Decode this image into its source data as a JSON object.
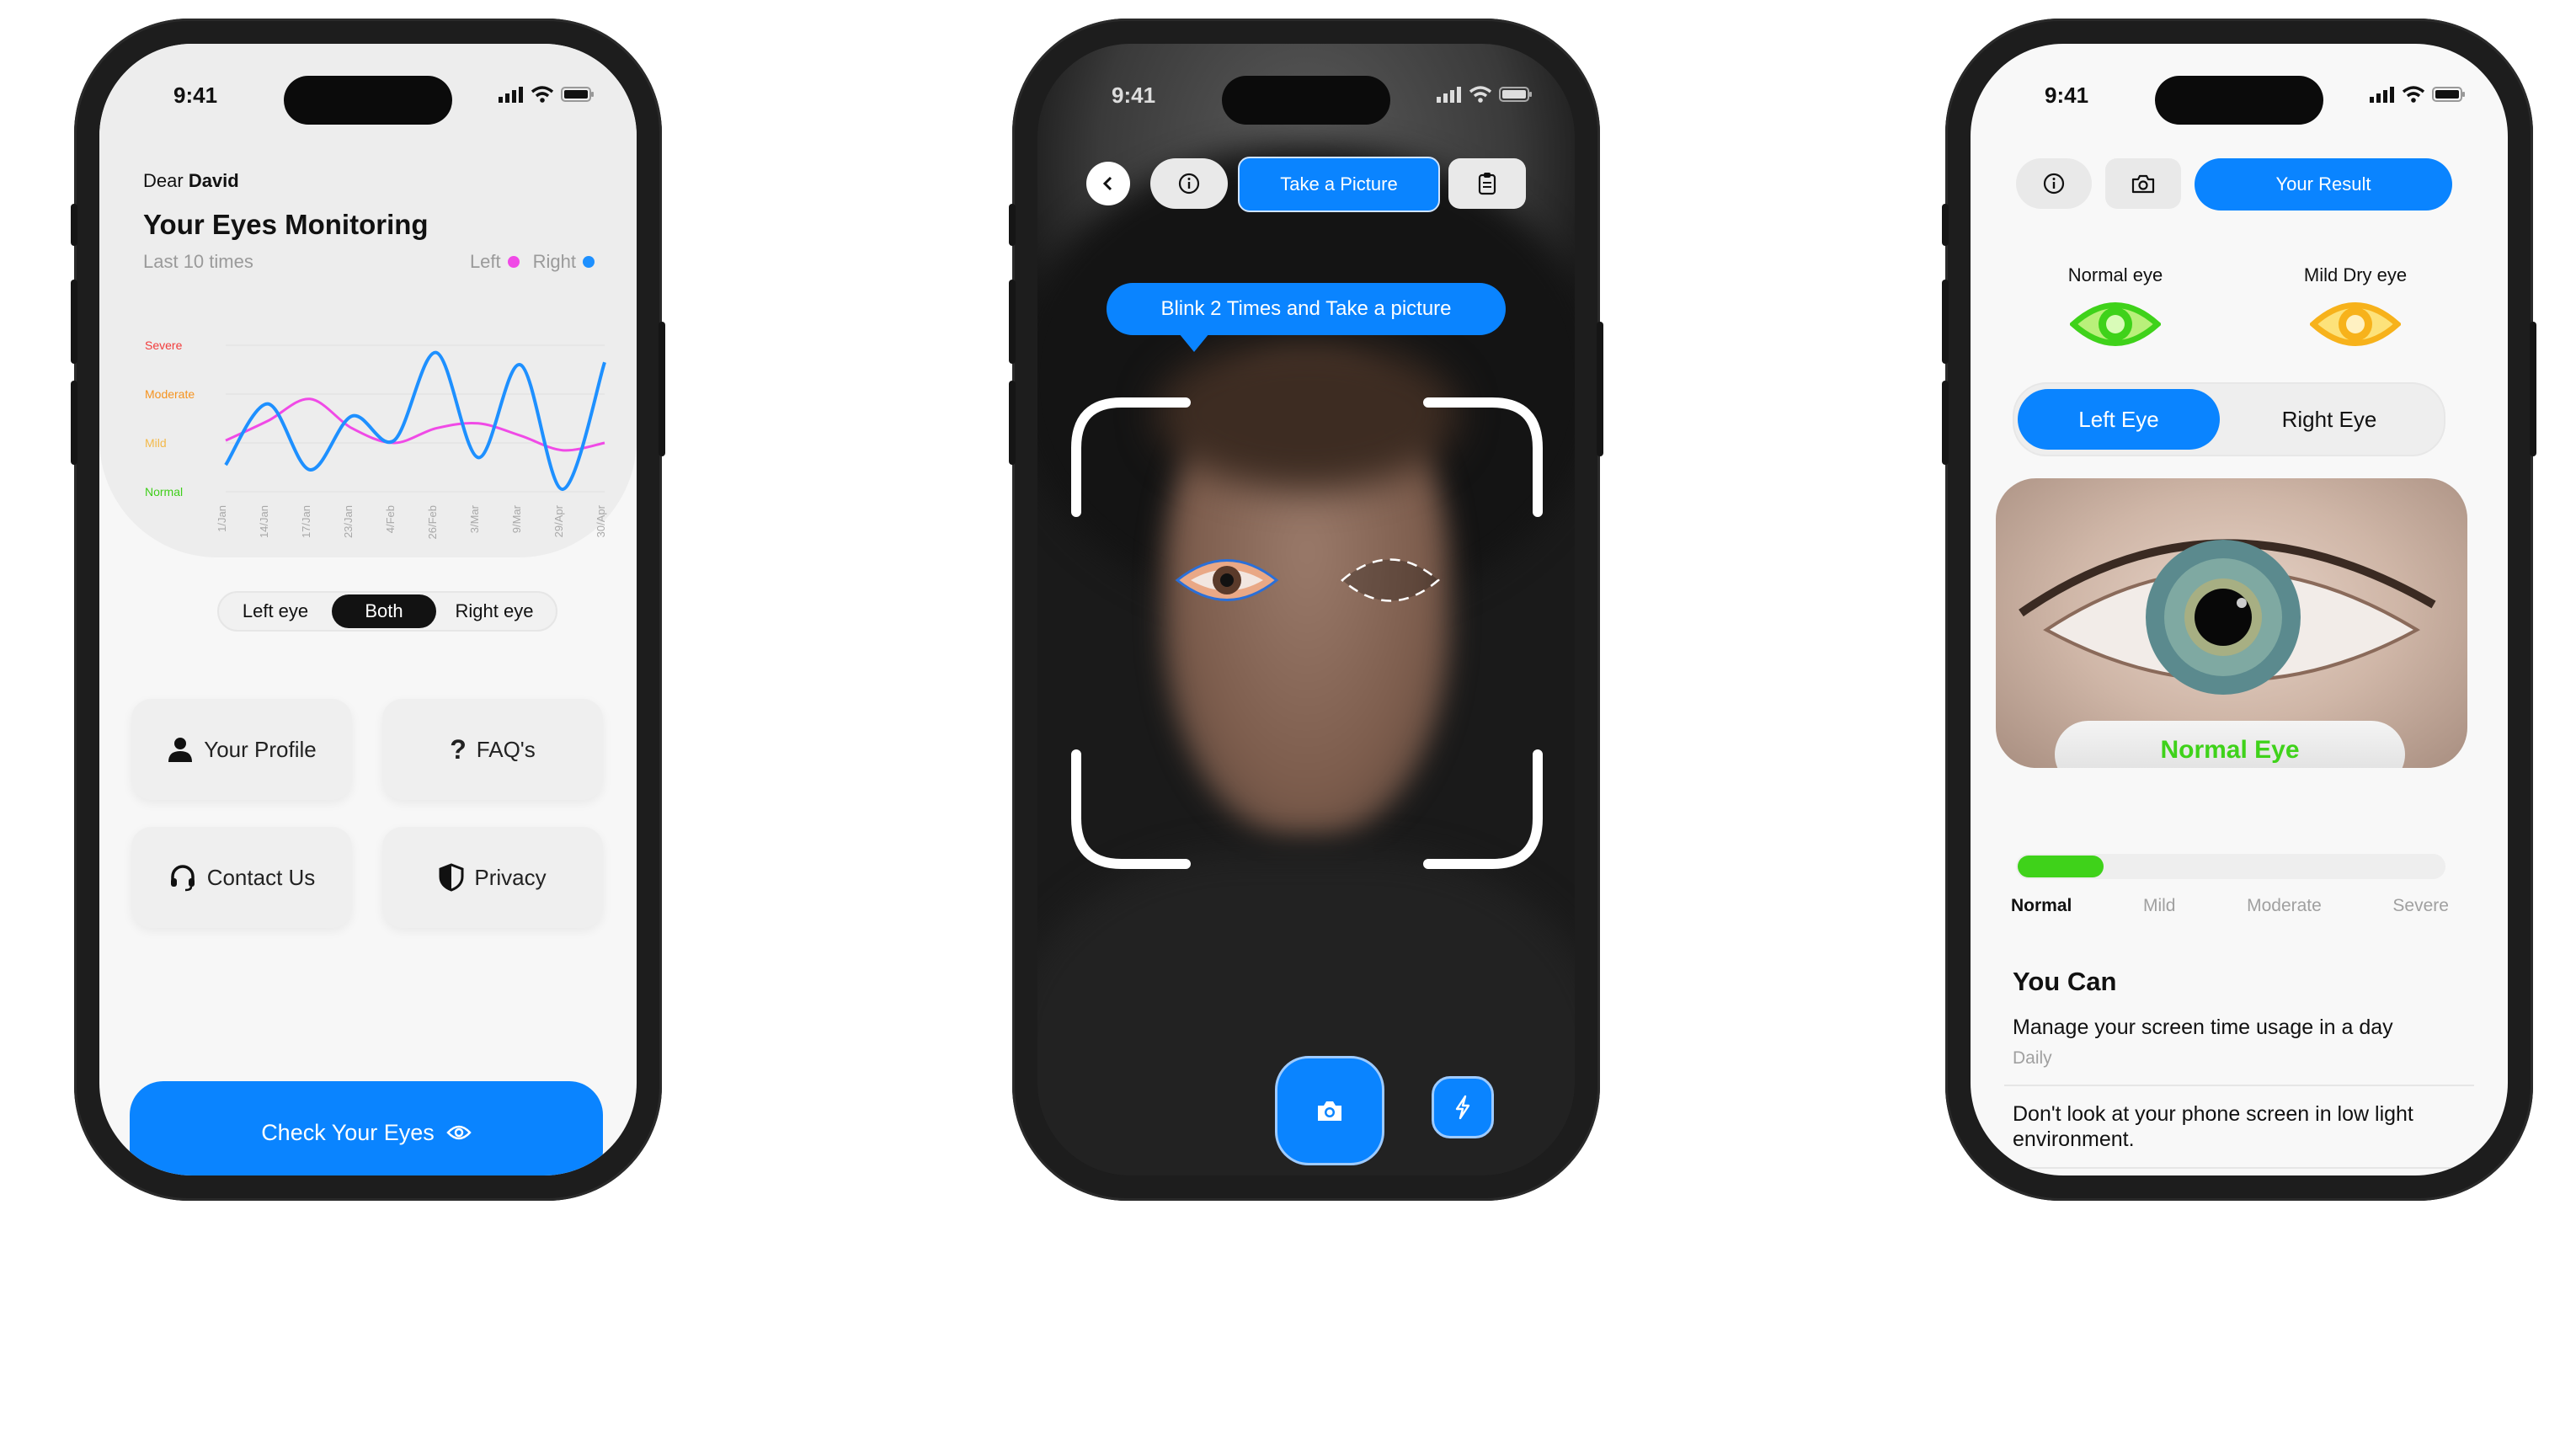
{
  "status_time": "9:41",
  "screen1": {
    "greeting_prefix": "Dear",
    "greeting_name": "David",
    "title": "Your Eyes Monitoring",
    "subtitle": "Last 10 times",
    "legend": [
      {
        "label": "Left",
        "color": "#f04ae6"
      },
      {
        "label": "Right",
        "color": "#1e90ff"
      }
    ],
    "levels": [
      {
        "label": "Severe",
        "color": "#f23b3b"
      },
      {
        "label": "Moderate",
        "color": "#f5931f"
      },
      {
        "label": "Mild",
        "color": "#f3b94a"
      },
      {
        "label": "Normal",
        "color": "#3fce1a"
      }
    ],
    "chart_data": {
      "type": "line",
      "categories": [
        "1/Jan",
        "14/Jan",
        "17/Jan",
        "23/Jan",
        "4/Feb",
        "26/Feb",
        "3/Mar",
        "9/Mar",
        "29/Apr",
        "30/Apr"
      ],
      "ylevels": [
        "Normal",
        "Mild",
        "Moderate",
        "Severe"
      ],
      "ylim": [
        0,
        3
      ],
      "series": [
        {
          "name": "Left",
          "color": "#f04ae6",
          "values": [
            1.05,
            1.45,
            1.9,
            1.3,
            1.0,
            1.3,
            1.4,
            1.15,
            0.85,
            1.0
          ]
        },
        {
          "name": "Right",
          "color": "#1e90ff",
          "values": [
            0.55,
            1.8,
            0.45,
            1.55,
            1.05,
            2.85,
            0.7,
            2.6,
            0.05,
            2.65
          ]
        }
      ]
    },
    "segment": {
      "items": [
        "Left eye",
        "Both",
        "Right eye"
      ],
      "selected": 1
    },
    "cards": [
      {
        "label": "Your Profile",
        "icon": "person-icon"
      },
      {
        "label": "FAQ's",
        "icon": "question-icon"
      },
      {
        "label": "Contact Us",
        "icon": "headset-icon"
      },
      {
        "label": "Privacy",
        "icon": "shield-icon"
      }
    ],
    "cta": "Check Your Eyes"
  },
  "screen2": {
    "take_picture": "Take a Picture",
    "tooltip": "Blink 2 Times and Take a picture"
  },
  "screen3": {
    "result_button": "Your Result",
    "eye_types": [
      {
        "label": "Normal eye",
        "color": "#3fd21a"
      },
      {
        "label": "Mild Dry eye",
        "color": "#f7b21b"
      }
    ],
    "tabs": [
      "Left Eye",
      "Right Eye"
    ],
    "selected_tab": 0,
    "eye_result": "Normal Eye",
    "severity": {
      "levels": [
        "Normal",
        "Mild",
        "Moderate",
        "Severe"
      ],
      "current": "Normal",
      "progress": 0.2
    },
    "you_can_title": "You Can",
    "tips": [
      {
        "text": "Manage your screen time usage in a day",
        "sub": "Daily"
      },
      {
        "text": "Don't look at your phone screen in low light environment.",
        "sub": ""
      }
    ]
  }
}
